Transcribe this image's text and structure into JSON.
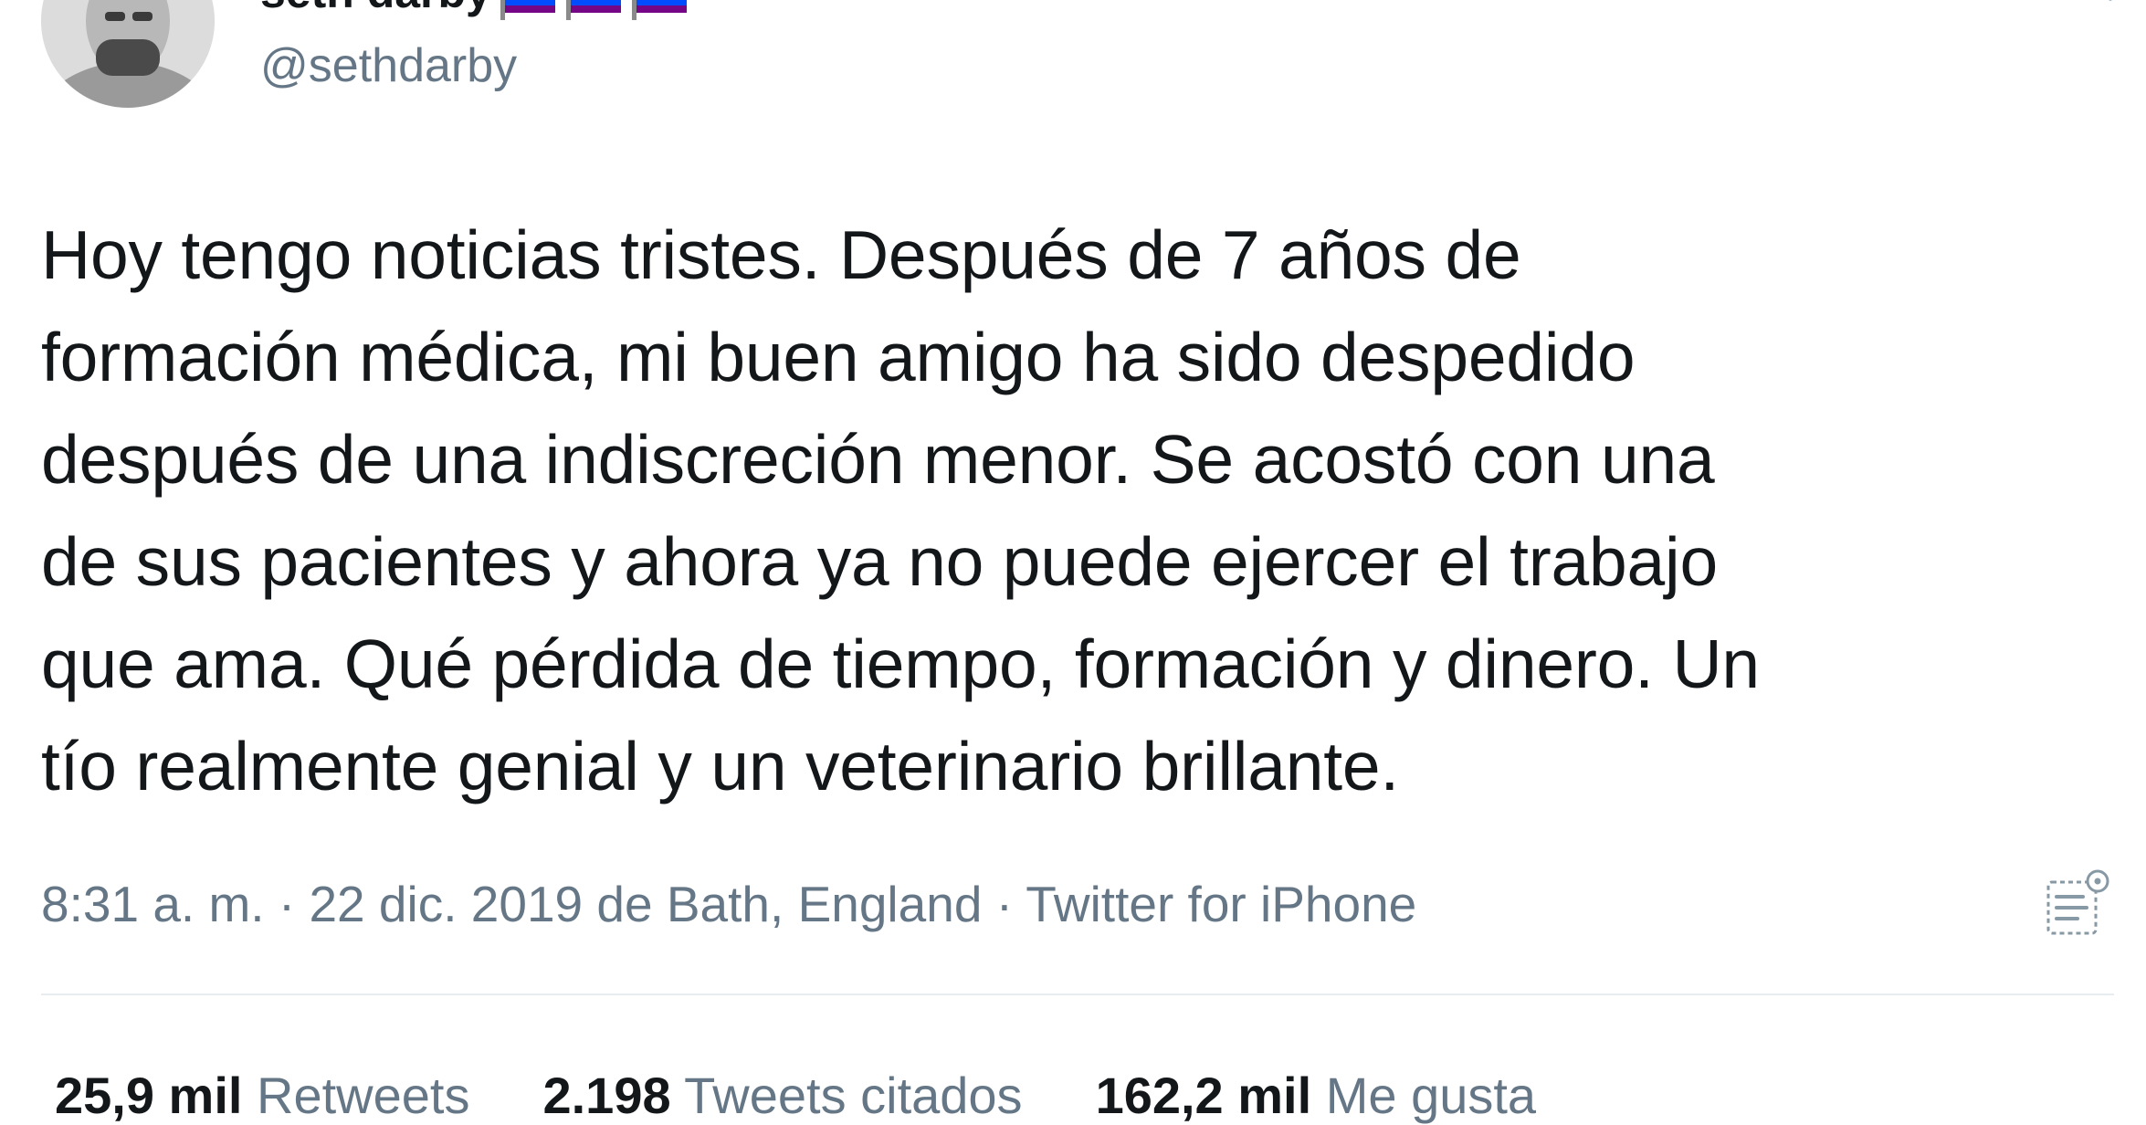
{
  "tweet": {
    "author": {
      "display_name": "seth darby",
      "name_emoji": "rainbow-flags",
      "handle": "@sethdarby",
      "avatar": "profile-photo"
    },
    "text": "Hoy tengo noticias tristes. Después de 7 años de\nformación médica, mi buen amigo ha sido despedido\ndespués de una indiscreción menor. Se acostó con una\nde sus pacientes y ahora ya no puede ejercer el trabajo\nque ama. Qué pérdida de tiempo, formación y dinero. Un\ntío realmente genial y un veterinario brillante.",
    "meta": "8:31 a. m. · 22 dic. 2019 de Bath, England · Twitter for iPhone",
    "analytics_icon": "analytics-icon",
    "stats": [
      {
        "count": "25,9 mil",
        "label": "Retweets"
      },
      {
        "count": "2.198",
        "label": "Tweets citados"
      },
      {
        "count": "162,2 mil",
        "label": "Me gusta"
      }
    ]
  },
  "colors": {
    "text": "#14171a",
    "secondary": "#657786",
    "divider": "#e6ecf0"
  }
}
